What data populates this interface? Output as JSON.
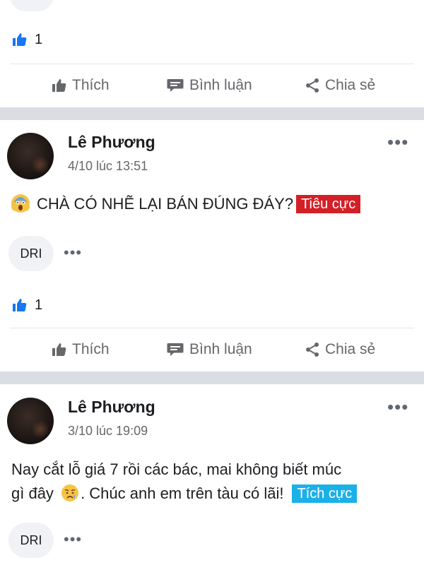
{
  "prev_post": {
    "like_count": "1",
    "actions": {
      "like": "Thích",
      "comment": "Bình luận",
      "share": "Chia sẻ"
    }
  },
  "posts": [
    {
      "author": "Lê Phương",
      "timestamp": "4/10 lúc 13:51",
      "text": "CHÀ CÓ NHẼ LẠI BÁN ĐÚNG ĐÁY?",
      "emoji": "scream-emoji",
      "badge": {
        "label": "Tiêu cực",
        "color": "#d32027"
      },
      "comment_preview": "DRI",
      "like_count": "1",
      "actions": {
        "like": "Thích",
        "comment": "Bình luận",
        "share": "Chia sẻ"
      }
    },
    {
      "author": "Lê Phương",
      "timestamp": "3/10 lúc 19:09",
      "text_line1": "Nay cắt lỗ giá 7 rồi các bác, mai không biết múc",
      "text_line2_a": "gì đây",
      "text_line2_b": ". Chúc anh em trên tàu có lãi!",
      "emoji": "sad-face-emoji",
      "badge": {
        "label": "Tích cực",
        "color": "#1cb0e8"
      },
      "comment_preview": "DRI"
    }
  ],
  "colors": {
    "like_blue": "#1877f2",
    "divider": "#dadde1",
    "muted": "#65676b"
  }
}
